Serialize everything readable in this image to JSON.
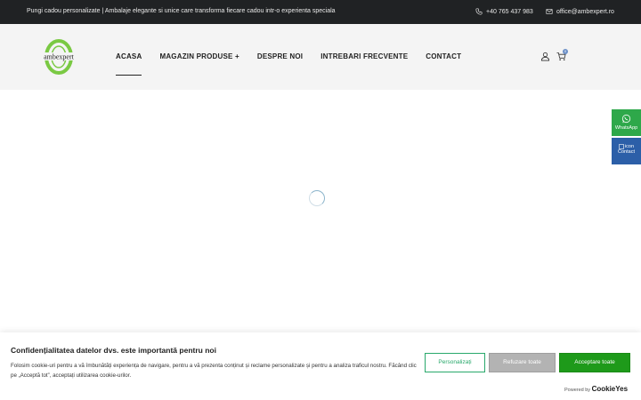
{
  "topbar": {
    "tagline": "Pungi cadou personalizate | Ambalaje elegante si unice care transforma fiecare cadou intr-o experienta speciala",
    "phone": "+40 765 437 983",
    "email": "office@ambexpert.ro"
  },
  "logo": {
    "text": "ambexpert"
  },
  "nav": {
    "items": [
      {
        "label": "ACASA"
      },
      {
        "label": "MAGAZIN PRODUSE +"
      },
      {
        "label": "DESPRE NOI"
      },
      {
        "label": "INTREBARI FRECVENTE"
      },
      {
        "label": "CONTACT"
      }
    ]
  },
  "cart": {
    "count": "0"
  },
  "side": {
    "whatsapp_label": "WhatsApp",
    "contact_label": "Contact",
    "contact_icon_alt": "icon"
  },
  "cookie": {
    "title": "Confidențialitatea datelor dvs. este importantă pentru noi",
    "body": "Folosim cookie-uri pentru a vă îmbunătăți experiența de navigare, pentru a vă prezenta conținut și reclame personalizate și pentru a analiza traficul nostru. Făcând clic pe „Acceptă tot”, acceptați utilizarea cookie-urilor.",
    "customize_label": "Personalizați",
    "reject_label": "Refuzare toate",
    "accept_label": "Acceptare toate",
    "powered_by": "Powered by",
    "brand": "CookieYes"
  },
  "colors": {
    "topbar_bg": "#202224",
    "header_bg": "#f4f4f4",
    "logo_green": "#7ac943",
    "accept_green": "#1e9a1a",
    "whatsapp_green": "#2ea84a",
    "contact_blue": "#2c5fa8"
  }
}
